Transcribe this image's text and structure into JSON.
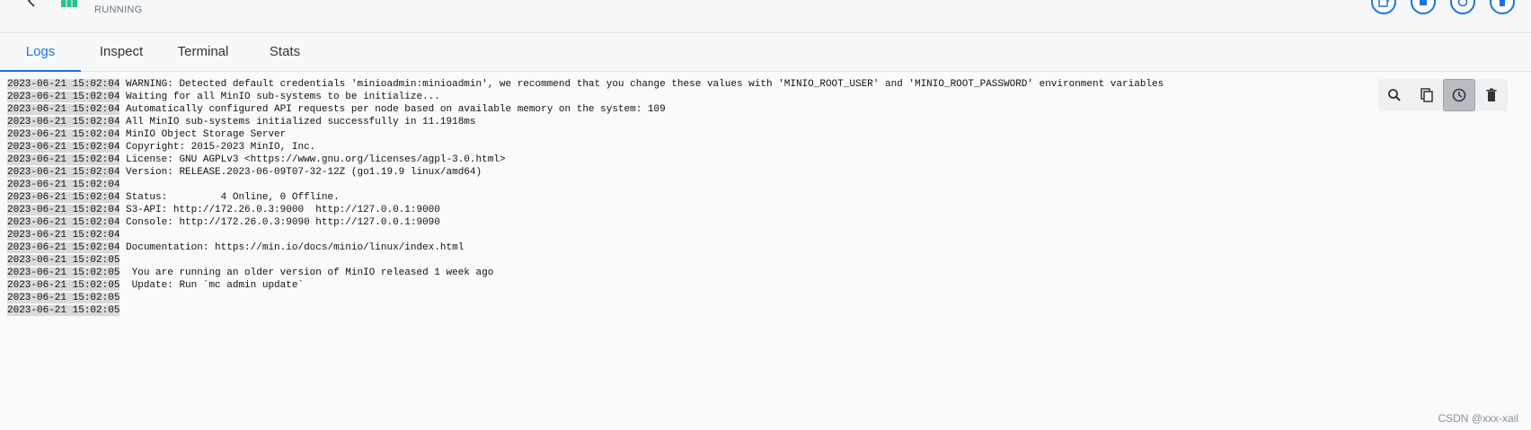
{
  "header": {
    "status": "RUNNING",
    "actions": [
      {
        "name": "open-external-icon"
      },
      {
        "name": "stop-icon"
      },
      {
        "name": "restart-icon"
      },
      {
        "name": "delete-icon"
      }
    ]
  },
  "tabs": [
    {
      "label": "Logs",
      "active": true
    },
    {
      "label": "Inspect",
      "active": false
    },
    {
      "label": "Terminal",
      "active": false
    },
    {
      "label": "Stats",
      "active": false
    }
  ],
  "logs": [
    {
      "ts": "2023-06-21 15:02:04",
      "msg": "WARNING: Detected default credentials 'minioadmin:minioadmin', we recommend that you change these values with 'MINIO_ROOT_USER' and 'MINIO_ROOT_PASSWORD' environment variables"
    },
    {
      "ts": "2023-06-21 15:02:04",
      "msg": "Waiting for all MinIO sub-systems to be initialize..."
    },
    {
      "ts": "2023-06-21 15:02:04",
      "msg": "Automatically configured API requests per node based on available memory on the system: 109"
    },
    {
      "ts": "2023-06-21 15:02:04",
      "msg": "All MinIO sub-systems initialized successfully in 11.1918ms"
    },
    {
      "ts": "2023-06-21 15:02:04",
      "msg": "MinIO Object Storage Server"
    },
    {
      "ts": "2023-06-21 15:02:04",
      "msg": "Copyright: 2015-2023 MinIO, Inc."
    },
    {
      "ts": "2023-06-21 15:02:04",
      "msg": "License: GNU AGPLv3 <https://www.gnu.org/licenses/agpl-3.0.html>"
    },
    {
      "ts": "2023-06-21 15:02:04",
      "msg": "Version: RELEASE.2023-06-09T07-32-12Z (go1.19.9 linux/amd64)"
    },
    {
      "ts": "2023-06-21 15:02:04",
      "msg": ""
    },
    {
      "ts": "2023-06-21 15:02:04",
      "msg": "Status:         4 Online, 0 Offline."
    },
    {
      "ts": "2023-06-21 15:02:04",
      "msg": "S3-API: http://172.26.0.3:9000  http://127.0.0.1:9000"
    },
    {
      "ts": "2023-06-21 15:02:04",
      "msg": "Console: http://172.26.0.3:9090 http://127.0.0.1:9090"
    },
    {
      "ts": "2023-06-21 15:02:04",
      "msg": ""
    },
    {
      "ts": "2023-06-21 15:02:04",
      "msg": "Documentation: https://min.io/docs/minio/linux/index.html"
    },
    {
      "ts": "2023-06-21 15:02:05",
      "msg": ""
    },
    {
      "ts": "2023-06-21 15:02:05",
      "msg": " You are running an older version of MinIO released 1 week ago"
    },
    {
      "ts": "2023-06-21 15:02:05",
      "msg": " Update: Run `mc admin update`"
    },
    {
      "ts": "2023-06-21 15:02:05",
      "msg": ""
    },
    {
      "ts": "2023-06-21 15:02:05",
      "msg": ""
    }
  ],
  "log_tools": [
    {
      "name": "search-icon",
      "active": false
    },
    {
      "name": "copy-icon",
      "active": false
    },
    {
      "name": "clock-icon",
      "active": true
    },
    {
      "name": "trash-icon",
      "active": false
    }
  ],
  "watermark": "CSDN @xxx-xail",
  "colors": {
    "accent": "#1a73e8",
    "container_icon": "#2bbf8f"
  }
}
